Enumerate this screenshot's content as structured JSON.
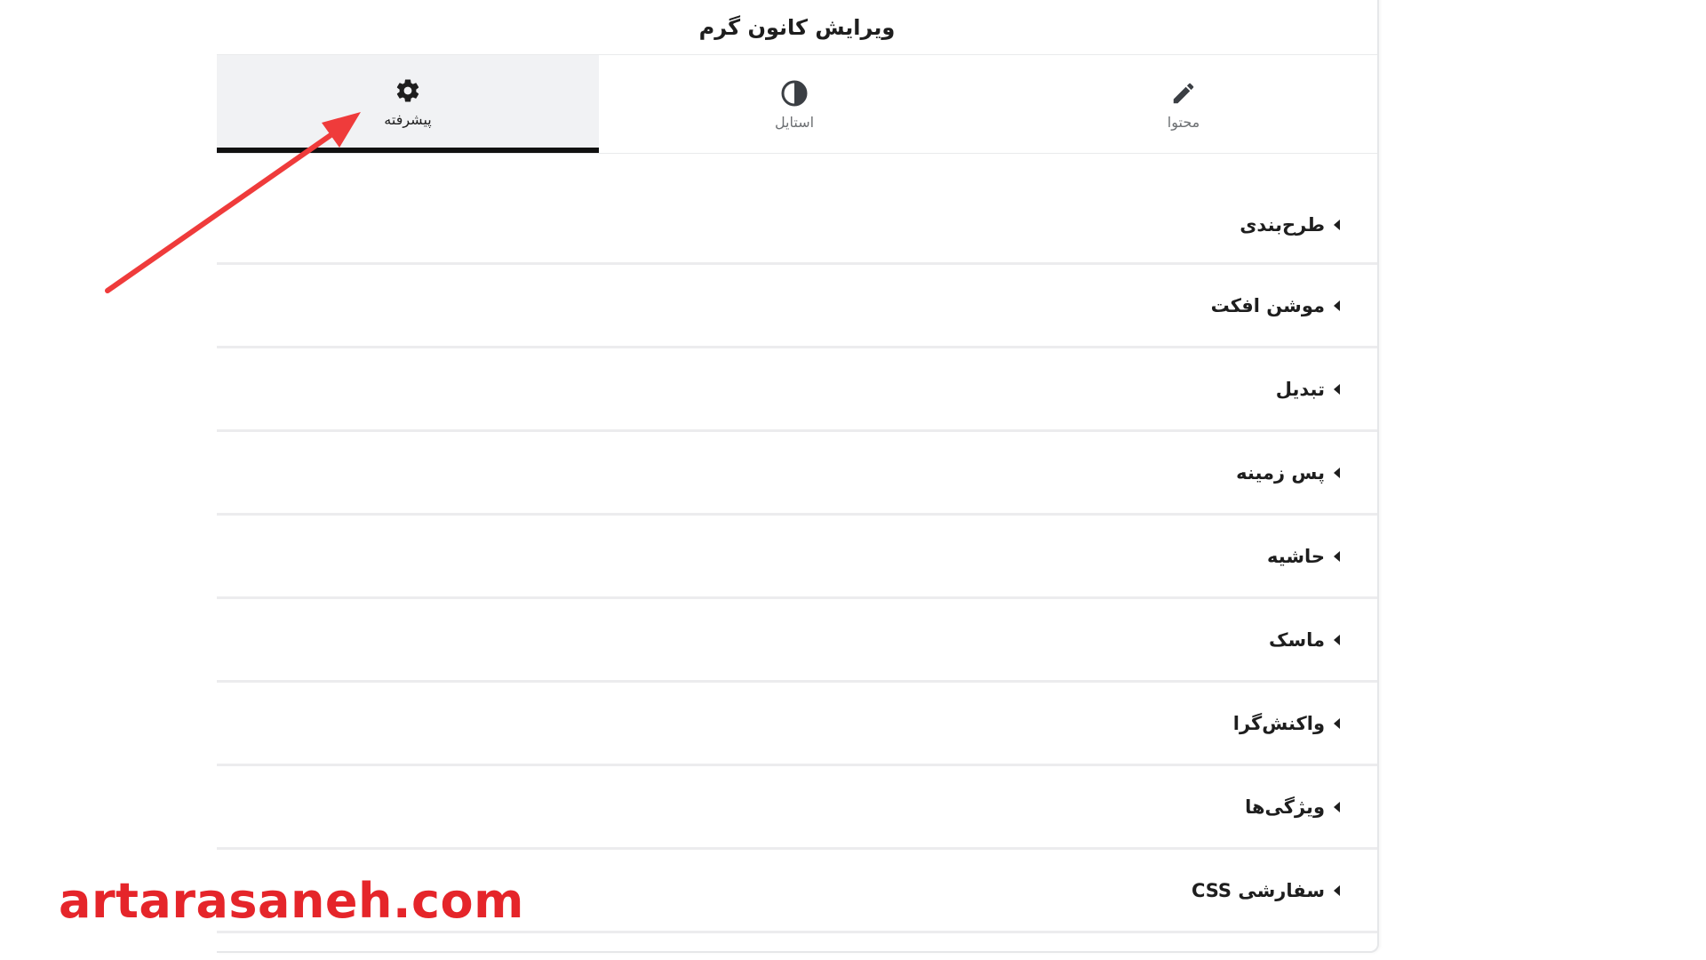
{
  "panel": {
    "title": "ویرایش کانون گرم"
  },
  "tabs": [
    {
      "id": "advanced",
      "label": "پیشرفته",
      "icon": "gear-icon",
      "active": true
    },
    {
      "id": "style",
      "label": "استایل",
      "icon": "half-circle-icon",
      "active": false
    },
    {
      "id": "content",
      "label": "محتوا",
      "icon": "pencil-icon",
      "active": false
    }
  ],
  "sections": [
    {
      "label": "طرح‌بندی"
    },
    {
      "label": "موشن افکت"
    },
    {
      "label": "تبدیل"
    },
    {
      "label": "پس زمینه"
    },
    {
      "label": "حاشیه"
    },
    {
      "label": "ماسک"
    },
    {
      "label": "واکنش‌گرا"
    },
    {
      "label": "ویژگی‌ها"
    },
    {
      "label": "CSS سفارشی"
    }
  ],
  "annotation": {
    "arrow_color": "#ef3b3b",
    "watermark": "artarasaneh.com",
    "watermark_color": "#e5252a"
  },
  "colors": {
    "active_tab_bg": "#f1f2f4",
    "active_tab_indicator": "#111111",
    "text": "#1e1e1e",
    "muted_text": "#6d7073"
  }
}
